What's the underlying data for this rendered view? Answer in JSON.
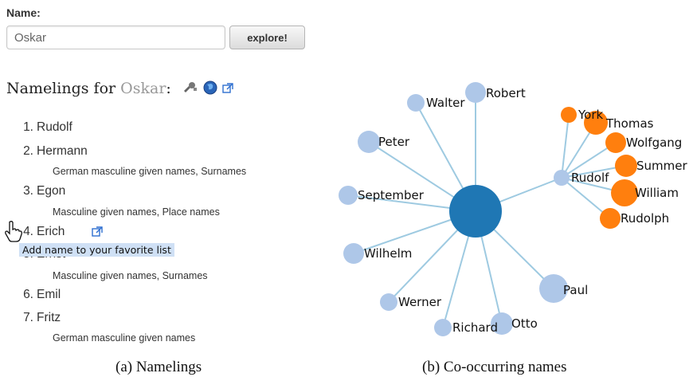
{
  "form": {
    "name_label": "Name:",
    "name_value": "Oskar",
    "explore_label": "explore!"
  },
  "namelings": {
    "heading_prefix": "Namelings for ",
    "heading_name": "Oskar",
    "heading_suffix": ":",
    "icons": [
      "tool-icon",
      "globe-icon",
      "external-link-icon"
    ],
    "items": [
      {
        "num": "1.",
        "name": "Rudolf",
        "categories": ""
      },
      {
        "num": "2.",
        "name": "Hermann",
        "categories": "German masculine given names,  Surnames"
      },
      {
        "num": "3.",
        "name": "Egon",
        "categories": "Masculine given names,  Place names"
      },
      {
        "num": "4.",
        "name": "Erich",
        "categories": ""
      },
      {
        "num": "5.",
        "name": "Ernst",
        "categories": "Masculine given names,  Surnames"
      },
      {
        "num": "6.",
        "name": "Emil",
        "categories": ""
      },
      {
        "num": "7.",
        "name": "Fritz",
        "categories": "German masculine given names"
      }
    ],
    "tooltip": "Add name to your favorite list"
  },
  "captions": {
    "left": "(a) Namelings",
    "right": "(b) Co-occurring names"
  },
  "graph": {
    "colors": {
      "center": "#1f77b4",
      "light": "#aec7e8",
      "orange": "#ff7f0e",
      "edge": "#9ecae1"
    },
    "nodes": [
      "Robert",
      "Walter",
      "Peter",
      "September",
      "Wilhelm",
      "Werner",
      "Richard",
      "Otto",
      "Paul",
      "Rudolf",
      "York",
      "Thomas",
      "Wolfgang",
      "Summer",
      "William",
      "Rudolph"
    ]
  }
}
